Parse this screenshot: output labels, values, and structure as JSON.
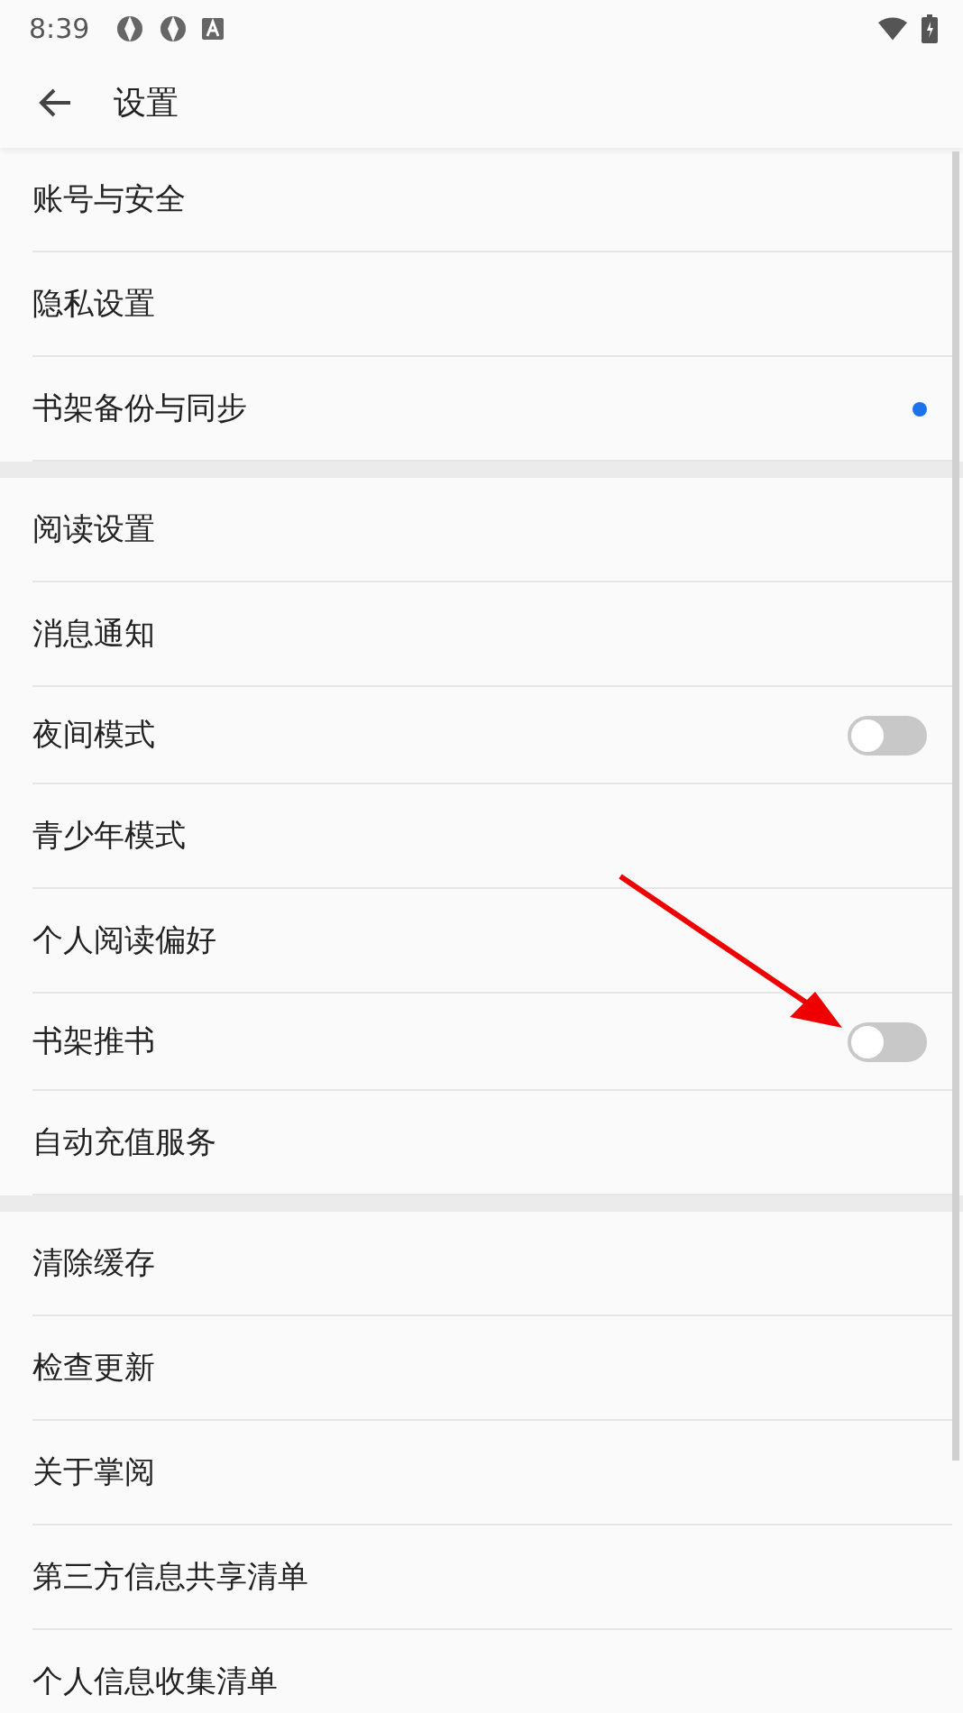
{
  "status_bar": {
    "time": "8:39"
  },
  "header": {
    "title": "设置"
  },
  "sections": [
    {
      "items": [
        {
          "kind": "plain",
          "label": "账号与安全"
        },
        {
          "kind": "plain",
          "label": "隐私设置"
        },
        {
          "kind": "dot",
          "label": "书架备份与同步",
          "color": "#1a73e8"
        }
      ]
    },
    {
      "items": [
        {
          "kind": "plain",
          "label": "阅读设置"
        },
        {
          "kind": "plain",
          "label": "消息通知"
        },
        {
          "kind": "toggle",
          "label": "夜间模式",
          "on": false
        },
        {
          "kind": "plain",
          "label": "青少年模式"
        },
        {
          "kind": "plain",
          "label": "个人阅读偏好"
        },
        {
          "kind": "toggle",
          "label": "书架推书",
          "on": false
        },
        {
          "kind": "plain",
          "label": "自动充值服务"
        }
      ]
    },
    {
      "items": [
        {
          "kind": "plain",
          "label": "清除缓存"
        },
        {
          "kind": "plain",
          "label": "检查更新"
        },
        {
          "kind": "plain",
          "label": "关于掌阅"
        },
        {
          "kind": "plain",
          "label": "第三方信息共享清单"
        },
        {
          "kind": "plain",
          "label": "个人信息收集清单"
        }
      ]
    }
  ]
}
